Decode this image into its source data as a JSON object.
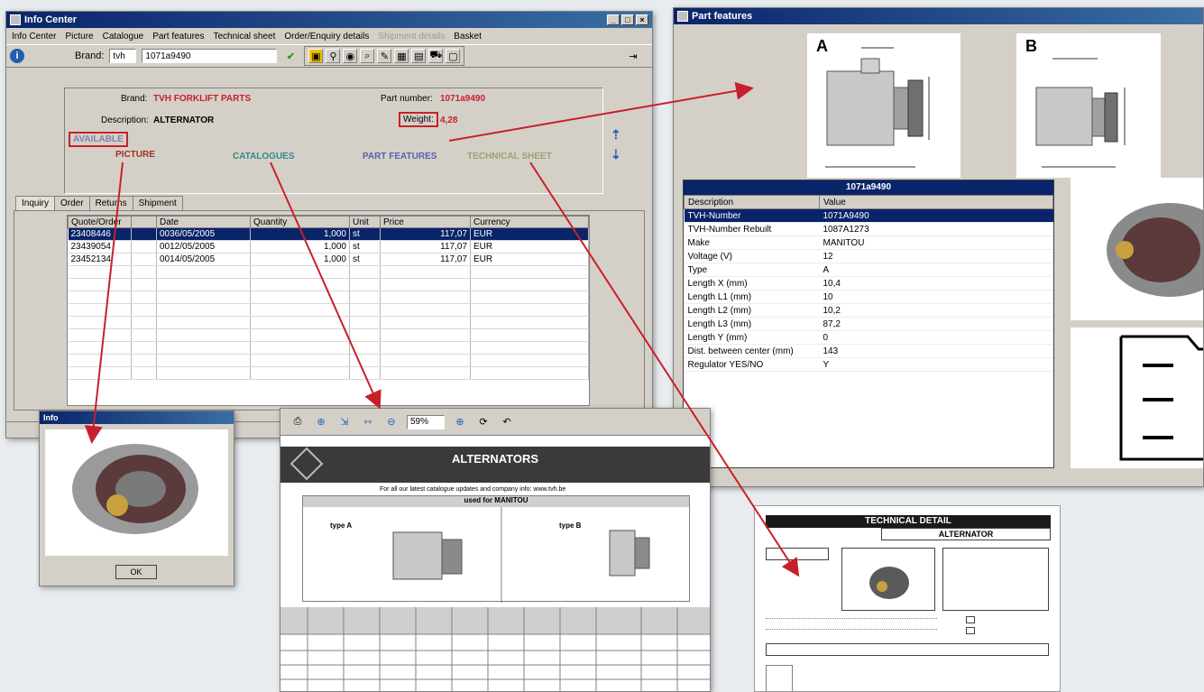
{
  "info_center": {
    "title": "Info Center",
    "menu": [
      "Info Center",
      "Picture",
      "Catalogue",
      "Part features",
      "Technical sheet",
      "Order/Enquiry details",
      "Shipment details",
      "Basket"
    ],
    "brand_label": "Brand:",
    "brand_value": "tvh",
    "part_value": "1071a9490",
    "info": {
      "brand_label": "Brand:",
      "brand_value": "TVH FORKLIFT PARTS",
      "part_label": "Part number:",
      "part_value": "1071a9490",
      "desc_label": "Description:",
      "desc_value": "ALTERNATOR",
      "weight_label": "Weight:",
      "weight_value": "4,28",
      "available": "AVAILABLE",
      "picture": "PICTURE",
      "catalogues": "CATALOGUES",
      "part_features": "PART FEATURES",
      "technical_sheet": "TECHNICAL SHEET"
    },
    "tabs": [
      "Inquiry",
      "Order",
      "Returns",
      "Shipment"
    ],
    "grid": {
      "columns": [
        "Quote/Order",
        "",
        "Date",
        "Quantity",
        "Unit",
        "Price",
        "Currency"
      ],
      "rows": [
        {
          "quote": "23408446",
          "date": "0036/05/2005",
          "qty": "1,000",
          "unit": "st",
          "price": "117,07",
          "cur": "EUR"
        },
        {
          "quote": "23439054",
          "date": "0012/05/2005",
          "qty": "1,000",
          "unit": "st",
          "price": "117,07",
          "cur": "EUR"
        },
        {
          "quote": "23452134",
          "date": "0014/05/2005",
          "qty": "1,000",
          "unit": "st",
          "price": "117,07",
          "cur": "EUR"
        }
      ]
    }
  },
  "part_features": {
    "title": "Part features",
    "diagram_a": "A",
    "diagram_b": "B",
    "table_title": "1071a9490",
    "columns": [
      "Description",
      "Value"
    ],
    "rows": [
      {
        "d": "TVH-Number",
        "v": "1071A9490"
      },
      {
        "d": "TVH-Number Rebuilt",
        "v": "1087A1273"
      },
      {
        "d": "Make",
        "v": "MANITOU"
      },
      {
        "d": "Voltage (V)",
        "v": "12"
      },
      {
        "d": "Type",
        "v": "A"
      },
      {
        "d": "Length X (mm)",
        "v": "10,4"
      },
      {
        "d": "Length L1 (mm)",
        "v": "10"
      },
      {
        "d": "Length L2 (mm)",
        "v": "10,2"
      },
      {
        "d": "Length L3 (mm)",
        "v": "87,2"
      },
      {
        "d": "Length Y (mm)",
        "v": "0"
      },
      {
        "d": "Dist. between center (mm)",
        "v": "143"
      },
      {
        "d": "Regulator YES/NO",
        "v": "Y"
      }
    ]
  },
  "picture_window": {
    "title": "Info",
    "ok": "OK"
  },
  "catalogue": {
    "zoom": "59%",
    "header": "ALTERNATORS",
    "subheader": "For all our latest catalogue updates and company info: www.tvh.be",
    "used_for": "used for MANITOU",
    "type_a": "type A",
    "type_b": "type B"
  },
  "tech_sheet": {
    "header": "TECHNICAL DETAIL",
    "subheader": "ALTERNATOR"
  }
}
